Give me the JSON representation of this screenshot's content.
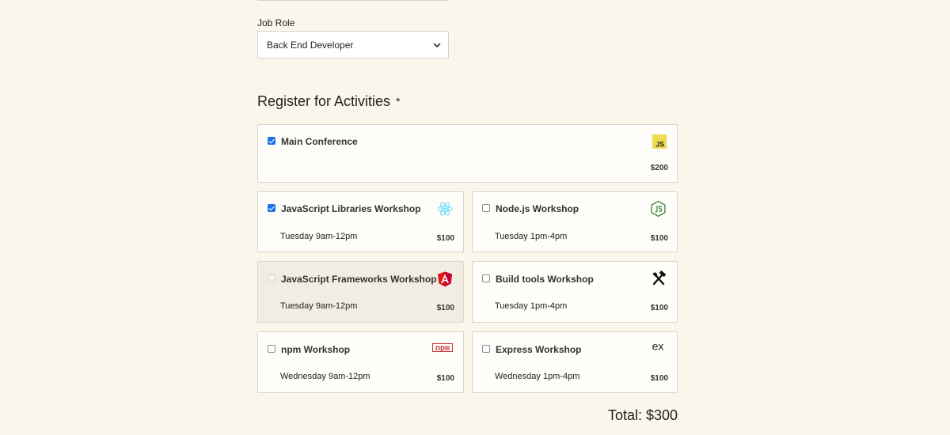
{
  "job_role": {
    "label": "Job Role",
    "selected": "Back End Developer"
  },
  "activities": {
    "legend": "Register for Activities",
    "required_mark": "*",
    "items": [
      {
        "name": "Main Conference",
        "time": "",
        "cost": "$200",
        "checked": true,
        "disabled": false,
        "icon": "javascript-icon"
      },
      {
        "name": "JavaScript Libraries Workshop",
        "time": "Tuesday 9am-12pm",
        "cost": "$100",
        "checked": true,
        "disabled": false,
        "icon": "react-icon"
      },
      {
        "name": "Node.js Workshop",
        "time": "Tuesday 1pm-4pm",
        "cost": "$100",
        "checked": false,
        "disabled": false,
        "icon": "nodejs-icon"
      },
      {
        "name": "JavaScript Frameworks Workshop",
        "time": "Tuesday 9am-12pm",
        "cost": "$100",
        "checked": false,
        "disabled": true,
        "icon": "angular-icon"
      },
      {
        "name": "Build tools Workshop",
        "time": "Tuesday 1pm-4pm",
        "cost": "$100",
        "checked": false,
        "disabled": false,
        "icon": "build-tools-icon"
      },
      {
        "name": "npm Workshop",
        "time": "Wednesday 9am-12pm",
        "cost": "$100",
        "checked": false,
        "disabled": false,
        "icon": "npm-icon"
      },
      {
        "name": "Express Workshop",
        "time": "Wednesday 1pm-4pm",
        "cost": "$100",
        "checked": false,
        "disabled": false,
        "icon": "express-icon"
      }
    ],
    "total": "Total: $300"
  },
  "icons": {
    "js_text": "JS",
    "npm_text": "npm",
    "express_text": "ex"
  },
  "colors": {
    "background": "#faf6ec",
    "checkbox_checked": "#1a73e8",
    "js_yellow": "#f0db4f",
    "react_cyan": "#61dafb",
    "node_green": "#3c873a",
    "angular_red": "#dd1b16",
    "npm_red": "#cb3837"
  }
}
